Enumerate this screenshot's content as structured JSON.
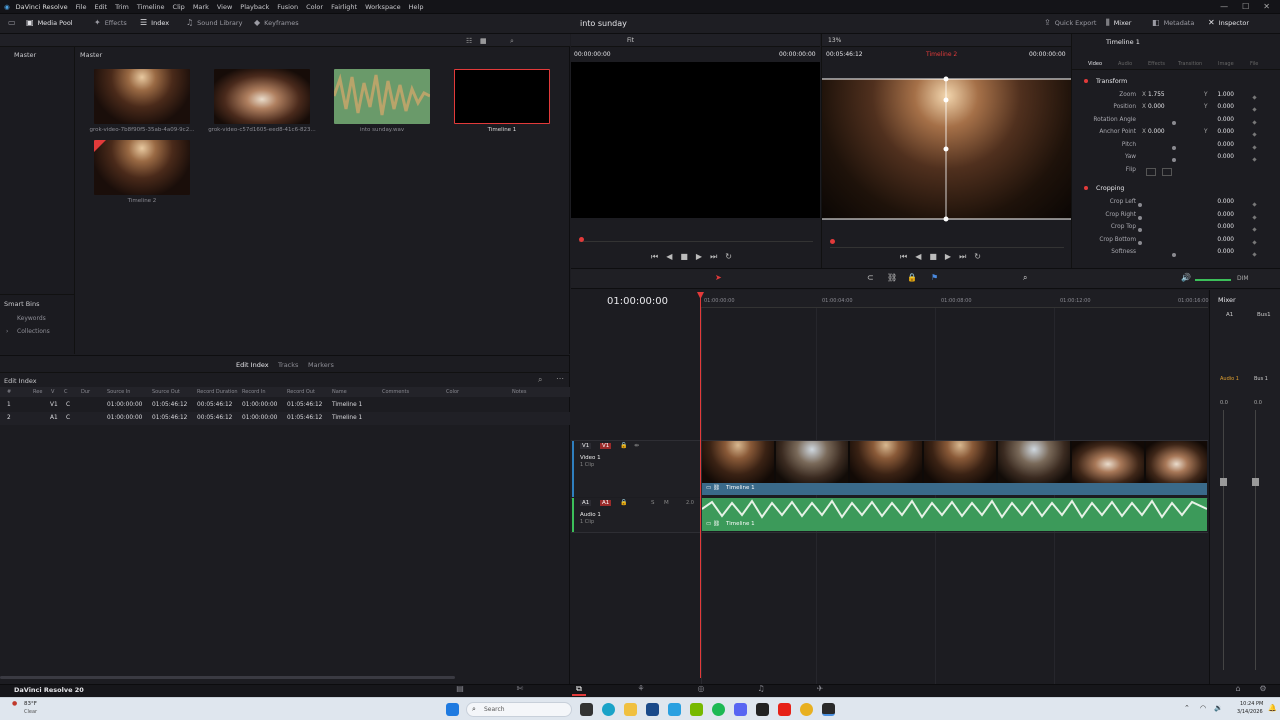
{
  "menubar": {
    "app": "DaVinci Resolve",
    "items": [
      "File",
      "Edit",
      "Trim",
      "Timeline",
      "Clip",
      "Mark",
      "View",
      "Playback",
      "Fusion",
      "Color",
      "Fairlight",
      "Workspace",
      "Help"
    ],
    "controls": [
      "—",
      "☐",
      "✕"
    ]
  },
  "toolbar": {
    "media_pool": "Media Pool",
    "effects": "Effects",
    "index": "Index",
    "sound_library": "Sound Library",
    "keyframes": "Keyframes",
    "project": "into sunday",
    "quick_export": "Quick Export",
    "mixer": "Mixer",
    "metadata": "Metadata",
    "inspector": "Inspector"
  },
  "media_pool": {
    "root": "Master",
    "bin": "Master",
    "clips": [
      {
        "name": "grok-video-7b8f90f5-35ab-4a09-9c2...",
        "kind": "video"
      },
      {
        "name": "grok-video-c57d1605-eed8-41c6-823...",
        "kind": "video"
      },
      {
        "name": "into sunday.wav",
        "kind": "audio"
      },
      {
        "name": "Timeline 1",
        "kind": "timeline"
      },
      {
        "name": "Timeline 2",
        "kind": "timeline"
      }
    ]
  },
  "smart_bins": {
    "title": "Smart Bins",
    "items": [
      "Keywords",
      "Collections"
    ]
  },
  "edit_index": {
    "tabs": [
      "Edit Index",
      "Tracks",
      "Markers"
    ],
    "title": "Edit Index",
    "columns": [
      "#",
      "Ree",
      "V",
      "C",
      "Dur",
      "Source In",
      "Source Out",
      "Record Duration",
      "Record In",
      "Record Out",
      "Name",
      "Comments",
      "Color",
      "Notes"
    ],
    "rows": [
      [
        "1",
        "",
        "V1",
        "C",
        "",
        "01:00:00:00",
        "01:05:46:12",
        "00:05:46:12",
        "01:00:00:00",
        "01:05:46:12",
        "Timeline 1"
      ],
      [
        "2",
        "",
        "A1",
        "C",
        "",
        "01:00:00:00",
        "01:05:46:12",
        "00:05:46:12",
        "01:00:00:00",
        "01:05:46:12",
        "Timeline 1"
      ]
    ]
  },
  "source_viewer": {
    "tc_left": "00:00:00:00",
    "tc_right": "00:00:00:00",
    "zoom": "Fit"
  },
  "timeline_viewer": {
    "zoom": "13%",
    "duration": "00:05:46:12",
    "timeline": "Timeline 2",
    "tc": "00:00:00:00"
  },
  "inspector": {
    "title": "Timeline 1",
    "tabs": [
      "Video",
      "Audio",
      "Effects",
      "Transition",
      "Image",
      "File"
    ],
    "transform": {
      "title": "Transform",
      "zoom_label": "Zoom",
      "zoom_x": "1.755",
      "zoom_y": "1.000",
      "position_label": "Position",
      "pos_x": "0.000",
      "pos_y": "0.000",
      "rotation_label": "Rotation Angle",
      "rotation": "0.000",
      "anchor_label": "Anchor Point",
      "anchor_x": "0.000",
      "anchor_y": "0.000",
      "pitch_label": "Pitch",
      "pitch": "0.000",
      "yaw_label": "Yaw",
      "yaw": "0.000",
      "flip_label": "Flip",
      "x": "X",
      "y": "Y"
    },
    "cropping": {
      "title": "Cropping",
      "left_label": "Crop Left",
      "left": "0.000",
      "right_label": "Crop Right",
      "right": "0.000",
      "top_label": "Crop Top",
      "top": "0.000",
      "bottom_label": "Crop Bottom",
      "bottom": "0.000",
      "softness_label": "Softness",
      "softness": "0.000"
    }
  },
  "timeline": {
    "timecode": "01:00:00:00",
    "ruler": [
      "01:00:00:00",
      "01:00:04:00",
      "01:00:08:00",
      "01:00:12:00",
      "01:00:16:00"
    ],
    "video_track": {
      "id": "V1",
      "sel": "V1",
      "name": "Video 1",
      "clips": "1 Clip",
      "clip_name": "Timeline 1"
    },
    "audio_track": {
      "id": "A1",
      "sel": "A1",
      "name": "Audio 1",
      "clips": "1 Clip",
      "level": "2.0",
      "clip_name": "Timeline 1"
    }
  },
  "mixer": {
    "title": "Mixer",
    "a1": "A1",
    "bus1": "Bus1",
    "audio1": "Audio 1",
    "bus1b": "Bus 1",
    "dim": "DIM",
    "val_a": "0.0",
    "val_b": "0.0"
  },
  "footer": {
    "brand": "DaVinci Resolve 20"
  },
  "taskbar": {
    "temp": "83°F",
    "weather": "Clear",
    "search": "Search",
    "time": "10:24 PM",
    "date": "3/14/2026"
  },
  "colors": {
    "accent": "#e23a3a",
    "audio": "#3c9a5a",
    "clip_bar": "#3a6a8a"
  }
}
